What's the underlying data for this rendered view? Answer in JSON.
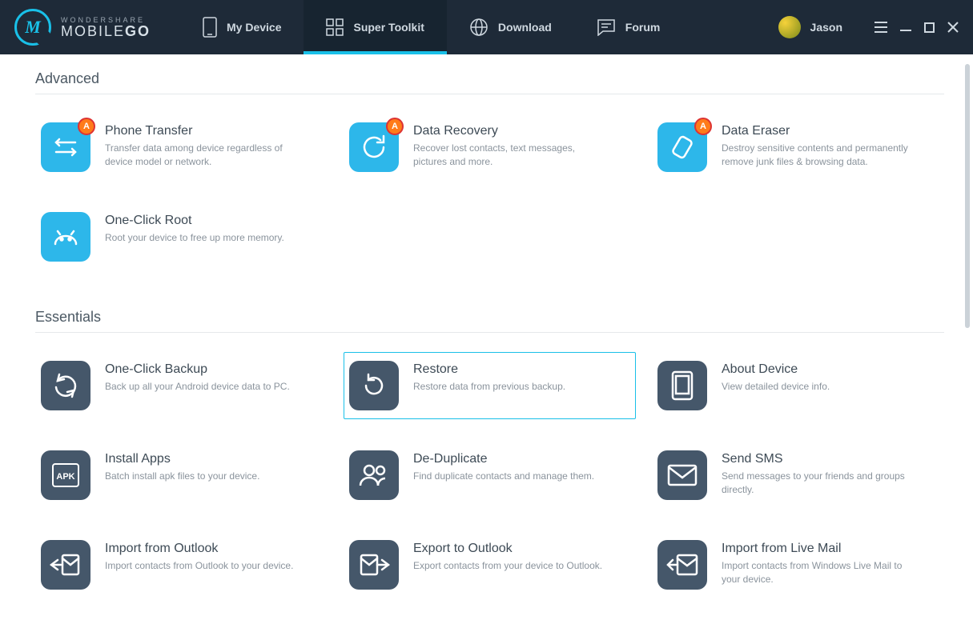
{
  "brand": {
    "sub": "WONDERSHARE",
    "main1": "MOBILE",
    "main2": "GO"
  },
  "nav": [
    {
      "label": "My Device"
    },
    {
      "label": "Super Toolkit"
    },
    {
      "label": "Download"
    },
    {
      "label": "Forum"
    }
  ],
  "user": {
    "name": "Jason"
  },
  "sections": {
    "advanced": {
      "title": "Advanced",
      "items": [
        {
          "title": "Phone Transfer",
          "desc": "Transfer data among device regardless of device model or network."
        },
        {
          "title": "Data Recovery",
          "desc": "Recover lost contacts, text messages, pictures and more."
        },
        {
          "title": "Data Eraser",
          "desc": "Destroy sensitive contents and permanently remove junk files & browsing data."
        },
        {
          "title": "One-Click Root",
          "desc": "Root your device to free up more memory."
        }
      ]
    },
    "essentials": {
      "title": "Essentials",
      "items": [
        {
          "title": "One-Click Backup",
          "desc": "Back up all your Android device data to PC."
        },
        {
          "title": "Restore",
          "desc": "Restore data from previous backup."
        },
        {
          "title": "About Device",
          "desc": "View detailed device info."
        },
        {
          "title": "Install Apps",
          "desc": "Batch install apk files to your device."
        },
        {
          "title": "De-Duplicate",
          "desc": "Find duplicate contacts and manage them."
        },
        {
          "title": "Send SMS",
          "desc": "Send messages to your friends and groups directly."
        },
        {
          "title": "Import from Outlook",
          "desc": "Import contacts from Outlook to your device."
        },
        {
          "title": "Export to Outlook",
          "desc": "Export contacts from your device to Outlook."
        },
        {
          "title": "Import from Live Mail",
          "desc": "Import contacts from Windows Live Mail to your device."
        }
      ]
    }
  }
}
